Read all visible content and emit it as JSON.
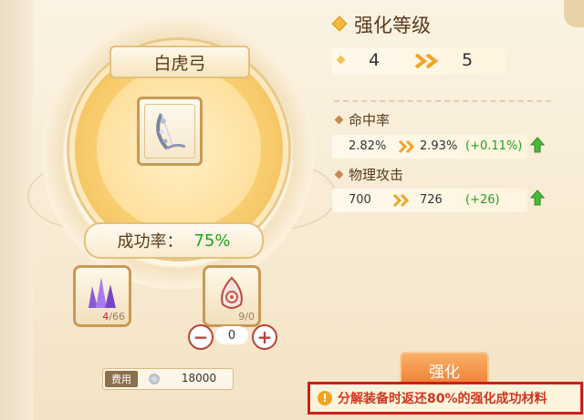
{
  "item": {
    "name": "白虎弓",
    "icon": "bow-icon"
  },
  "success": {
    "label": "成功率：",
    "value": "75%"
  },
  "materials": [
    {
      "icon": "purple-crystal-icon",
      "owned": "4",
      "required": "/66"
    },
    {
      "icon": "talisman-stone-icon",
      "count": "9/0"
    }
  ],
  "stepper": {
    "value": "0",
    "minus": "−",
    "plus": "+"
  },
  "cost": {
    "label": "费用",
    "amount": "18000",
    "icon": "silver-coin-icon"
  },
  "panel": {
    "title": "强化等级",
    "level_from": "4",
    "level_to": "5",
    "stats": [
      {
        "label": "命中率",
        "from": "2.82%",
        "to": "2.93%",
        "gain": "(+0.11%)"
      },
      {
        "label": "物理攻击",
        "from": "700",
        "to": "726",
        "gain": "(+26)"
      }
    ]
  },
  "action": {
    "label": "强化"
  },
  "notice": {
    "text": "分解装备时返还80%的强化成功材料",
    "icon": "warning-icon"
  },
  "colors": {
    "gain": "#1fa31f",
    "notice": "#d2351d",
    "button": "#ee7e30",
    "accent_gold": "#f3b93a"
  }
}
